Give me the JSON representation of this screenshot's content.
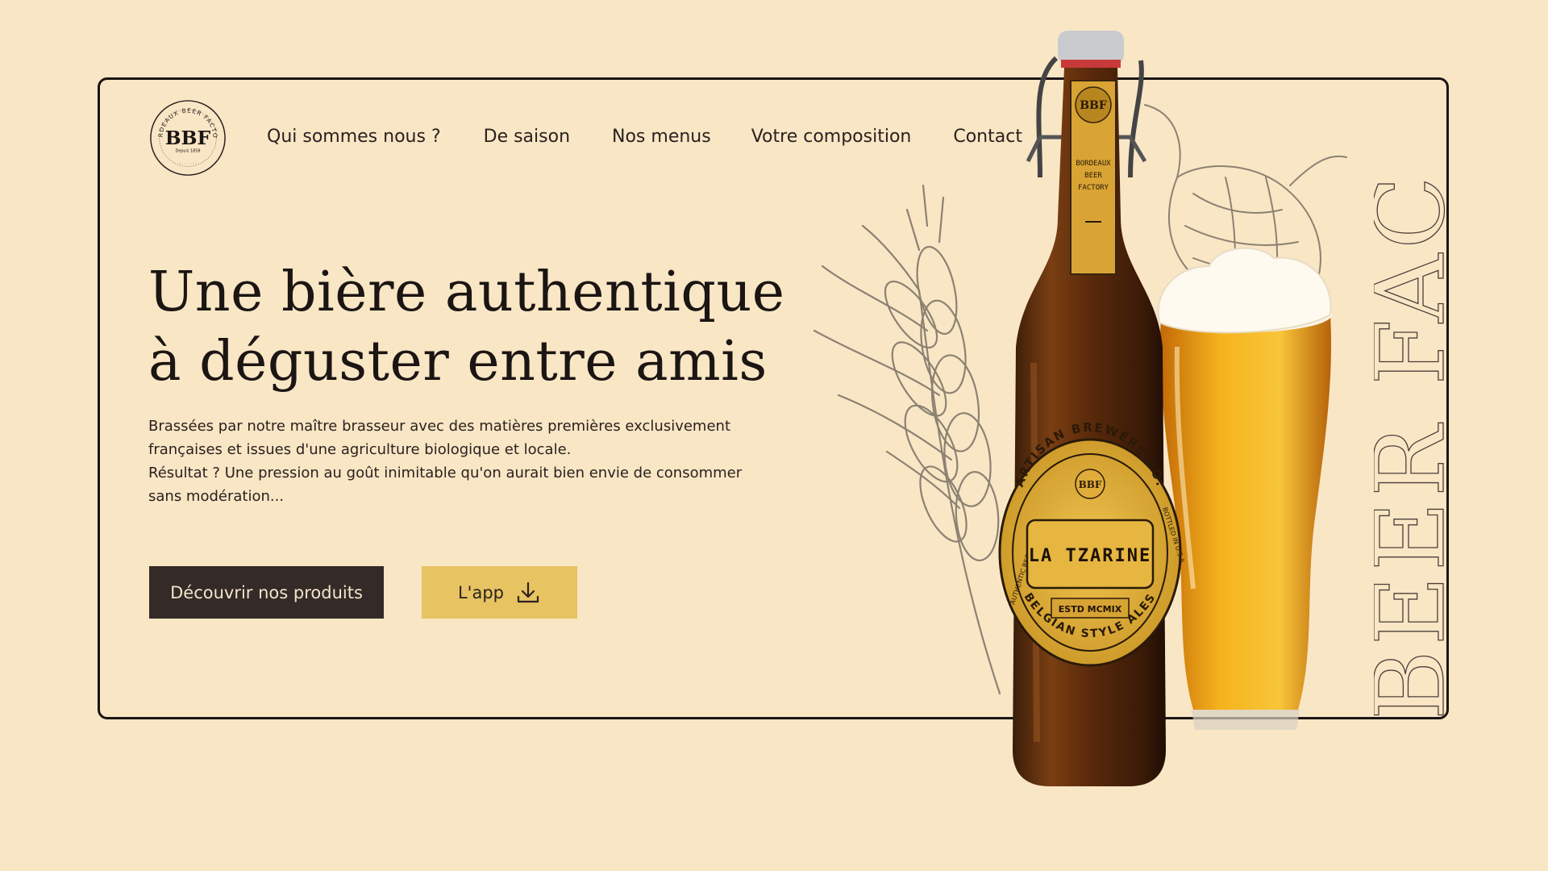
{
  "brand": {
    "logo_text": "BBF",
    "logo_ring": "BORDEAUX BEER FACTORY",
    "logo_since": "Depuis 1858"
  },
  "nav": {
    "items": [
      {
        "label": "Qui sommes nous ?"
      },
      {
        "label": "De saison"
      },
      {
        "label": "Nos menus"
      },
      {
        "label": "Votre composition"
      },
      {
        "label": "Contact"
      }
    ]
  },
  "hero": {
    "headline_line1": "Une bière authentique",
    "headline_line2": "à déguster entre amis",
    "description": [
      "Brassées par notre maître brasseur avec des matières premières exclusivement",
      "françaises et issues d'une agriculture biologique et locale.",
      "Résultat ? Une pression au goût inimitable qu'on aurait bien envie de consommer",
      "sans modération..."
    ],
    "cta_primary": "Découvrir nos produits",
    "cta_app": "L'app"
  },
  "product": {
    "neck_label": [
      "BBF",
      "BORDEAUX",
      "BEER",
      "FACTORY"
    ],
    "label_ring_top": "ARTISAN BREWERS CO.",
    "label_ring_bottom": "BELGIAN STYLE ALES",
    "label_left": "AUTHENTIC RECIPE",
    "label_right": "BOTTLED IN U.S.A.",
    "label_name": "LA TZARINE",
    "label_estd": "ESTD MCMIX",
    "label_mark": "BBF"
  },
  "decor": {
    "vertical_word": "BEER FAC"
  },
  "colors": {
    "background": "#f9e6c5",
    "dark": "#342a27",
    "accent_gold": "#e7c361"
  }
}
